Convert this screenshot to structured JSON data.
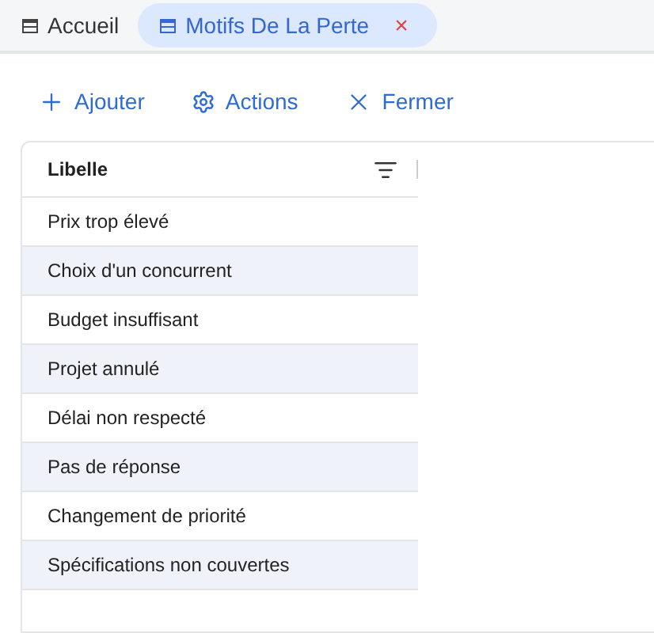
{
  "tabs": [
    {
      "label": "Accueil",
      "selected": false
    },
    {
      "label": "Motifs De La Perte",
      "selected": true,
      "close": "×"
    }
  ],
  "toolbar": [
    "Ajouter",
    "Actions",
    "Fermer"
  ],
  "table": {
    "columns": [
      "Libelle"
    ],
    "rows": [
      "Prix trop élevé",
      "Choix d'un concurrent",
      "Budget insuffisant",
      "Projet annulé",
      "Délai non respecté",
      "Pas de réponse",
      "Changement de priorité",
      "Spécifications non couvertes"
    ]
  }
}
